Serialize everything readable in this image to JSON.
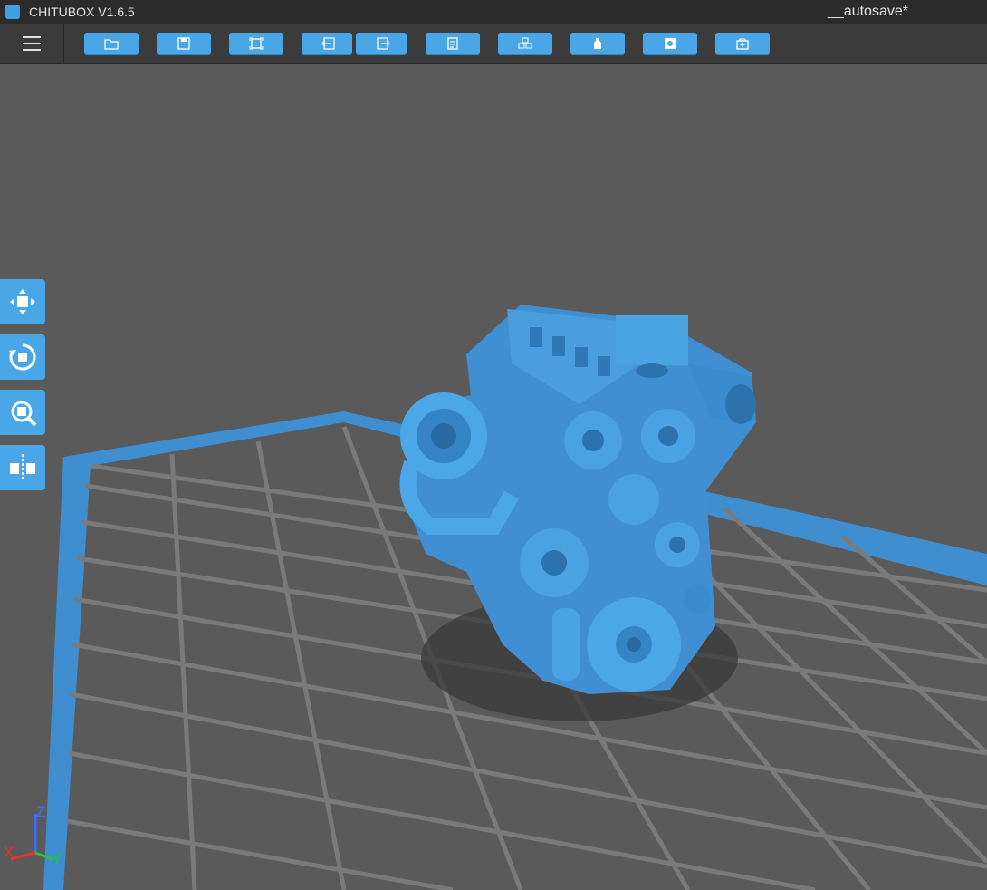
{
  "window": {
    "app_title": "CHITUBOX V1.6.5",
    "file_name": "__autosave*"
  },
  "toolbar": {
    "buttons": [
      {
        "name": "open-file",
        "icon": "folder-icon"
      },
      {
        "name": "save",
        "icon": "floppy-icon"
      },
      {
        "name": "fit-view",
        "icon": "frame-icon"
      },
      {
        "name": "undo",
        "icon": "arrow-left-icon"
      },
      {
        "name": "redo",
        "icon": "arrow-right-icon"
      },
      {
        "name": "settings",
        "icon": "document-icon"
      },
      {
        "name": "arrange",
        "icon": "cubes-icon"
      },
      {
        "name": "support",
        "icon": "bottle-icon"
      },
      {
        "name": "hollow",
        "icon": "square-hole-icon"
      },
      {
        "name": "slice",
        "icon": "package-icon"
      }
    ]
  },
  "side_tools": [
    {
      "name": "move",
      "icon": "move-icon"
    },
    {
      "name": "rotate",
      "icon": "rotate-icon"
    },
    {
      "name": "scale",
      "icon": "scale-icon"
    },
    {
      "name": "mirror",
      "icon": "mirror-icon"
    }
  ],
  "axes": {
    "x_label": "X",
    "y_label": "Y",
    "z_label": "Z",
    "x_color": "#e8332f",
    "y_color": "#29c33a",
    "z_color": "#3b6fff"
  },
  "colors": {
    "accent": "#49a7e8",
    "platform": "#3f8fd0",
    "model": "#3f8fd2",
    "grid": "#7a7a7a"
  }
}
